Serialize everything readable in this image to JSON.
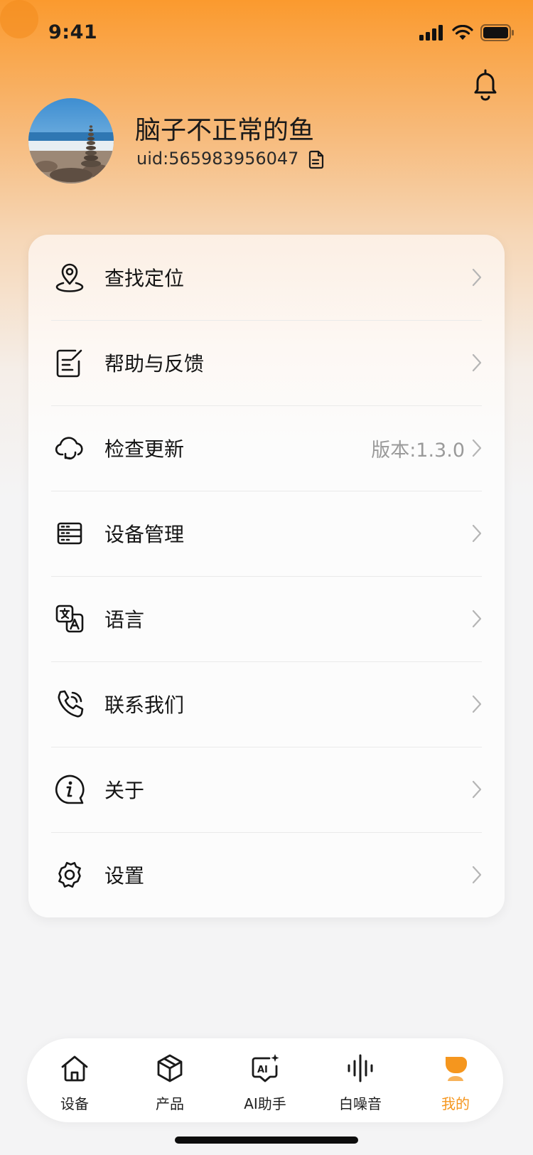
{
  "status_bar": {
    "time": "9:41"
  },
  "profile": {
    "name": "脑子不正常的鱼",
    "uid": "uid:565983956047"
  },
  "menu": [
    {
      "id": "location",
      "label": "查找定位",
      "value": "",
      "icon": "location-pin-icon"
    },
    {
      "id": "help",
      "label": "帮助与反馈",
      "value": "",
      "icon": "feedback-note-icon"
    },
    {
      "id": "update",
      "label": "检查更新",
      "value": "版本:1.3.0",
      "icon": "cloud-refresh-icon"
    },
    {
      "id": "devices",
      "label": "设备管理",
      "value": "",
      "icon": "device-list-icon"
    },
    {
      "id": "language",
      "label": "语言",
      "value": "",
      "icon": "translate-icon"
    },
    {
      "id": "contact",
      "label": "联系我们",
      "value": "",
      "icon": "phone-icon"
    },
    {
      "id": "about",
      "label": "关于",
      "value": "",
      "icon": "info-icon"
    },
    {
      "id": "settings",
      "label": "设置",
      "value": "",
      "icon": "gear-icon"
    }
  ],
  "tabs": [
    {
      "label": "设备",
      "icon": "home-icon",
      "active": false
    },
    {
      "label": "产品",
      "icon": "box-icon",
      "active": false
    },
    {
      "label": "AI助手",
      "icon": "ai-chat-icon",
      "active": false
    },
    {
      "label": "白噪音",
      "icon": "sound-wave-icon",
      "active": false
    },
    {
      "label": "我的",
      "icon": "profile-icon",
      "active": true
    }
  ],
  "colors": {
    "accent": "#F5961E",
    "header_top": "#FB9A2E",
    "text": "#151515",
    "muted": "#9a9a9a"
  }
}
